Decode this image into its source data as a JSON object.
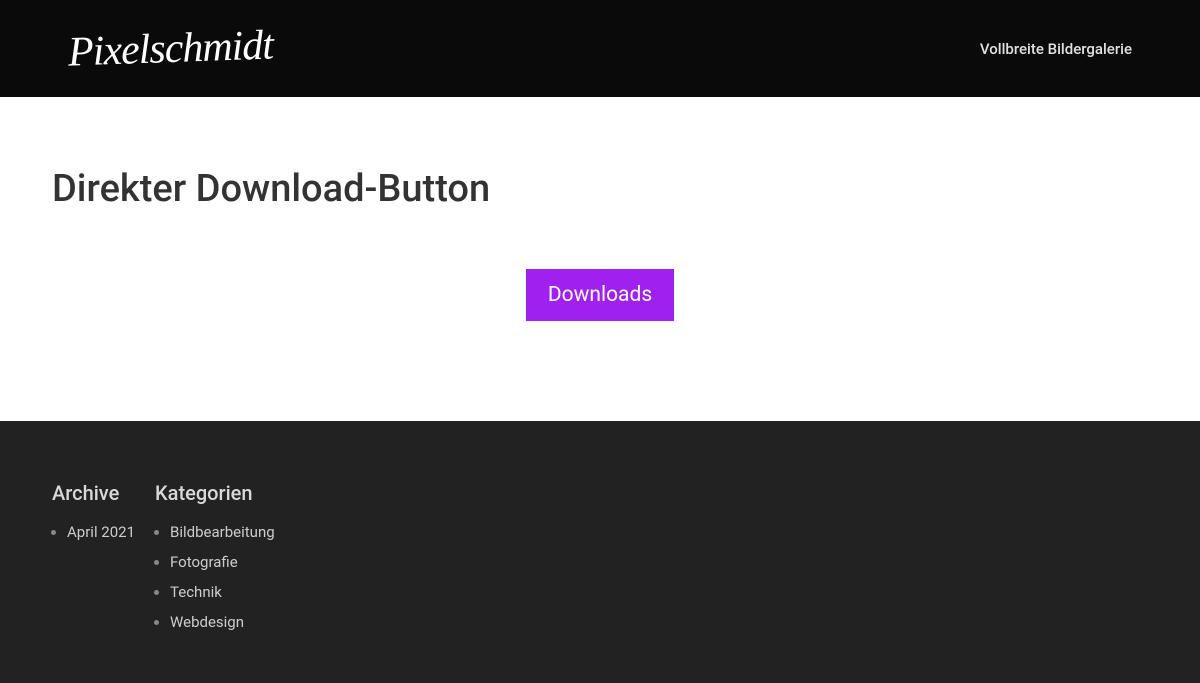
{
  "header": {
    "logo": "Pixelschmidt",
    "nav_link": "Vollbreite Bildergalerie"
  },
  "main": {
    "title": "Direkter Download-Button",
    "button_label": "Downloads"
  },
  "footer": {
    "archive": {
      "heading": "Archive",
      "items": [
        "April 2021"
      ]
    },
    "categories": {
      "heading": "Kategorien",
      "items": [
        "Bildbearbeitung",
        "Fotografie",
        "Technik",
        "Webdesign"
      ]
    }
  }
}
